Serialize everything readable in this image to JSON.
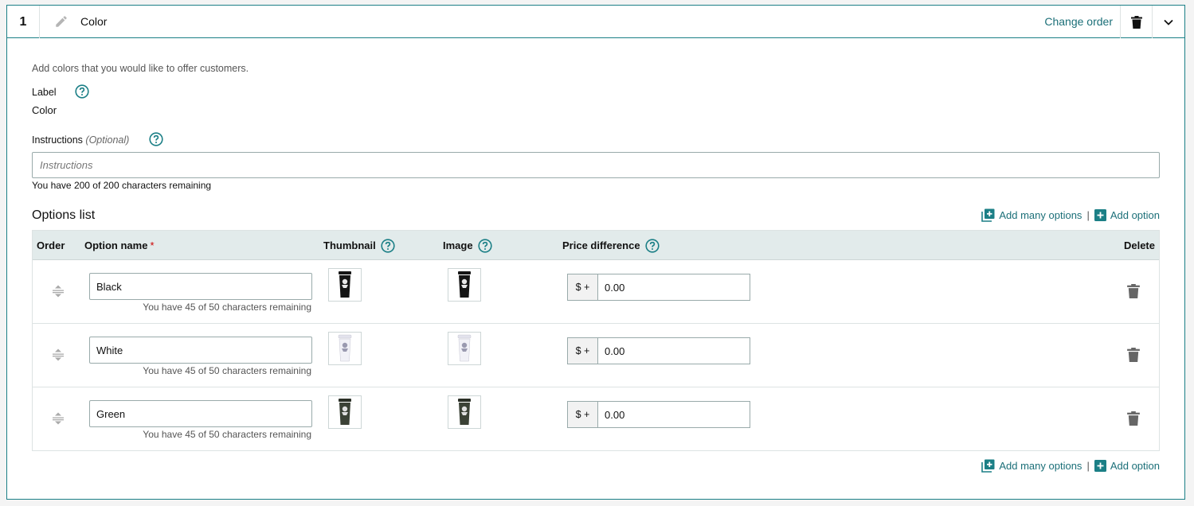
{
  "header": {
    "step_number": "1",
    "title": "Color",
    "change_order_label": "Change order"
  },
  "section": {
    "description": "Add colors that you would like to offer customers.",
    "label_label": "Label",
    "label_value": "Color",
    "instructions_label": "Instructions",
    "instructions_optional": "(Optional)",
    "instructions_placeholder": "Instructions",
    "instructions_value": "",
    "instructions_count": "You have 200 of 200 characters remaining"
  },
  "options": {
    "title": "Options list",
    "add_many_label": "Add many options",
    "separator": "|",
    "add_option_label": "Add option",
    "columns": {
      "order": "Order",
      "option_name": "Option name",
      "required_mark": "*",
      "thumbnail": "Thumbnail",
      "image": "Image",
      "price_difference": "Price difference",
      "delete": "Delete"
    },
    "rows": [
      {
        "name": "Black",
        "char_count": "You have 45 of 50 characters remaining",
        "price_prefix": "$ +",
        "price": "0.00",
        "swatch_color": "#151515",
        "logo_color": "#e8e8e8"
      },
      {
        "name": "White",
        "char_count": "You have 45 of 50 characters remaining",
        "price_prefix": "$ +",
        "price": "0.00",
        "swatch_color": "#f1f1f7",
        "logo_color": "#9a9ab0"
      },
      {
        "name": "Green",
        "char_count": "You have 45 of 50 characters remaining",
        "price_prefix": "$ +",
        "price": "0.00",
        "swatch_color": "#3b4236",
        "logo_color": "#e0e0e0"
      }
    ]
  },
  "colors": {
    "accent": "#1b7f86",
    "link": "#1b6f78",
    "table_header_bg": "#e2ebeb"
  }
}
